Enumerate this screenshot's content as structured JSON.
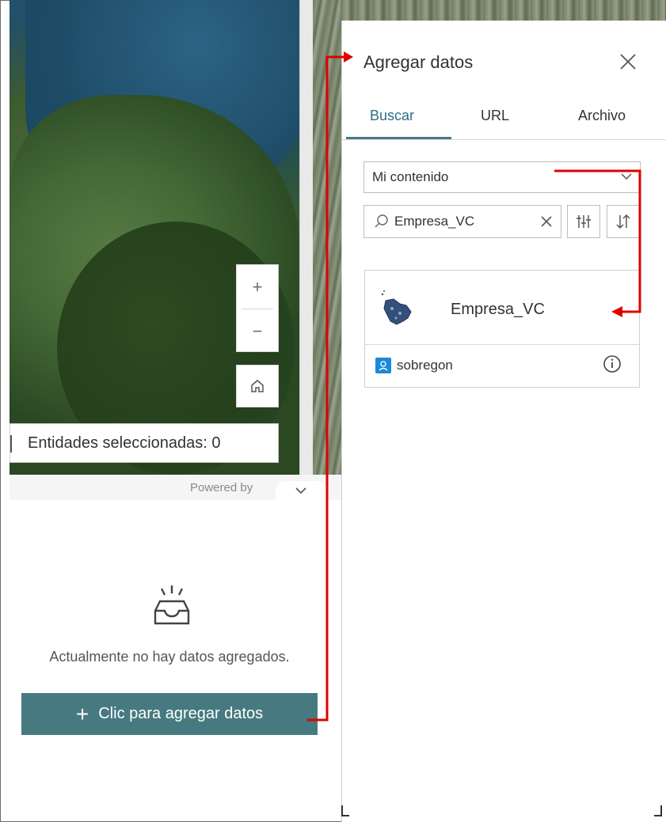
{
  "map": {
    "zoom_in": "+",
    "zoom_out": "−",
    "home_icon": "home-icon",
    "selection_label": "Entidades seleccionadas: 0",
    "attribution": "Powered by"
  },
  "empty_state": {
    "icon": "inbox-icon",
    "message": "Actualmente no hay datos agregados.",
    "add_button": "Clic para agregar datos",
    "add_plus": "+"
  },
  "add_data_panel": {
    "title": "Agregar datos",
    "tabs": [
      {
        "label": "Buscar",
        "active": true
      },
      {
        "label": "URL",
        "active": false
      },
      {
        "label": "Archivo",
        "active": false
      }
    ],
    "source_select": "Mi contenido",
    "search_value": "Empresa_VC",
    "results": [
      {
        "name": "Empresa_VC",
        "owner": "sobregon"
      }
    ]
  },
  "colors": {
    "accent": "#467a80",
    "active_tab_text": "#2e6f86",
    "owner_badge": "#1b8ad6",
    "annotation_arrow": "#e00000"
  }
}
